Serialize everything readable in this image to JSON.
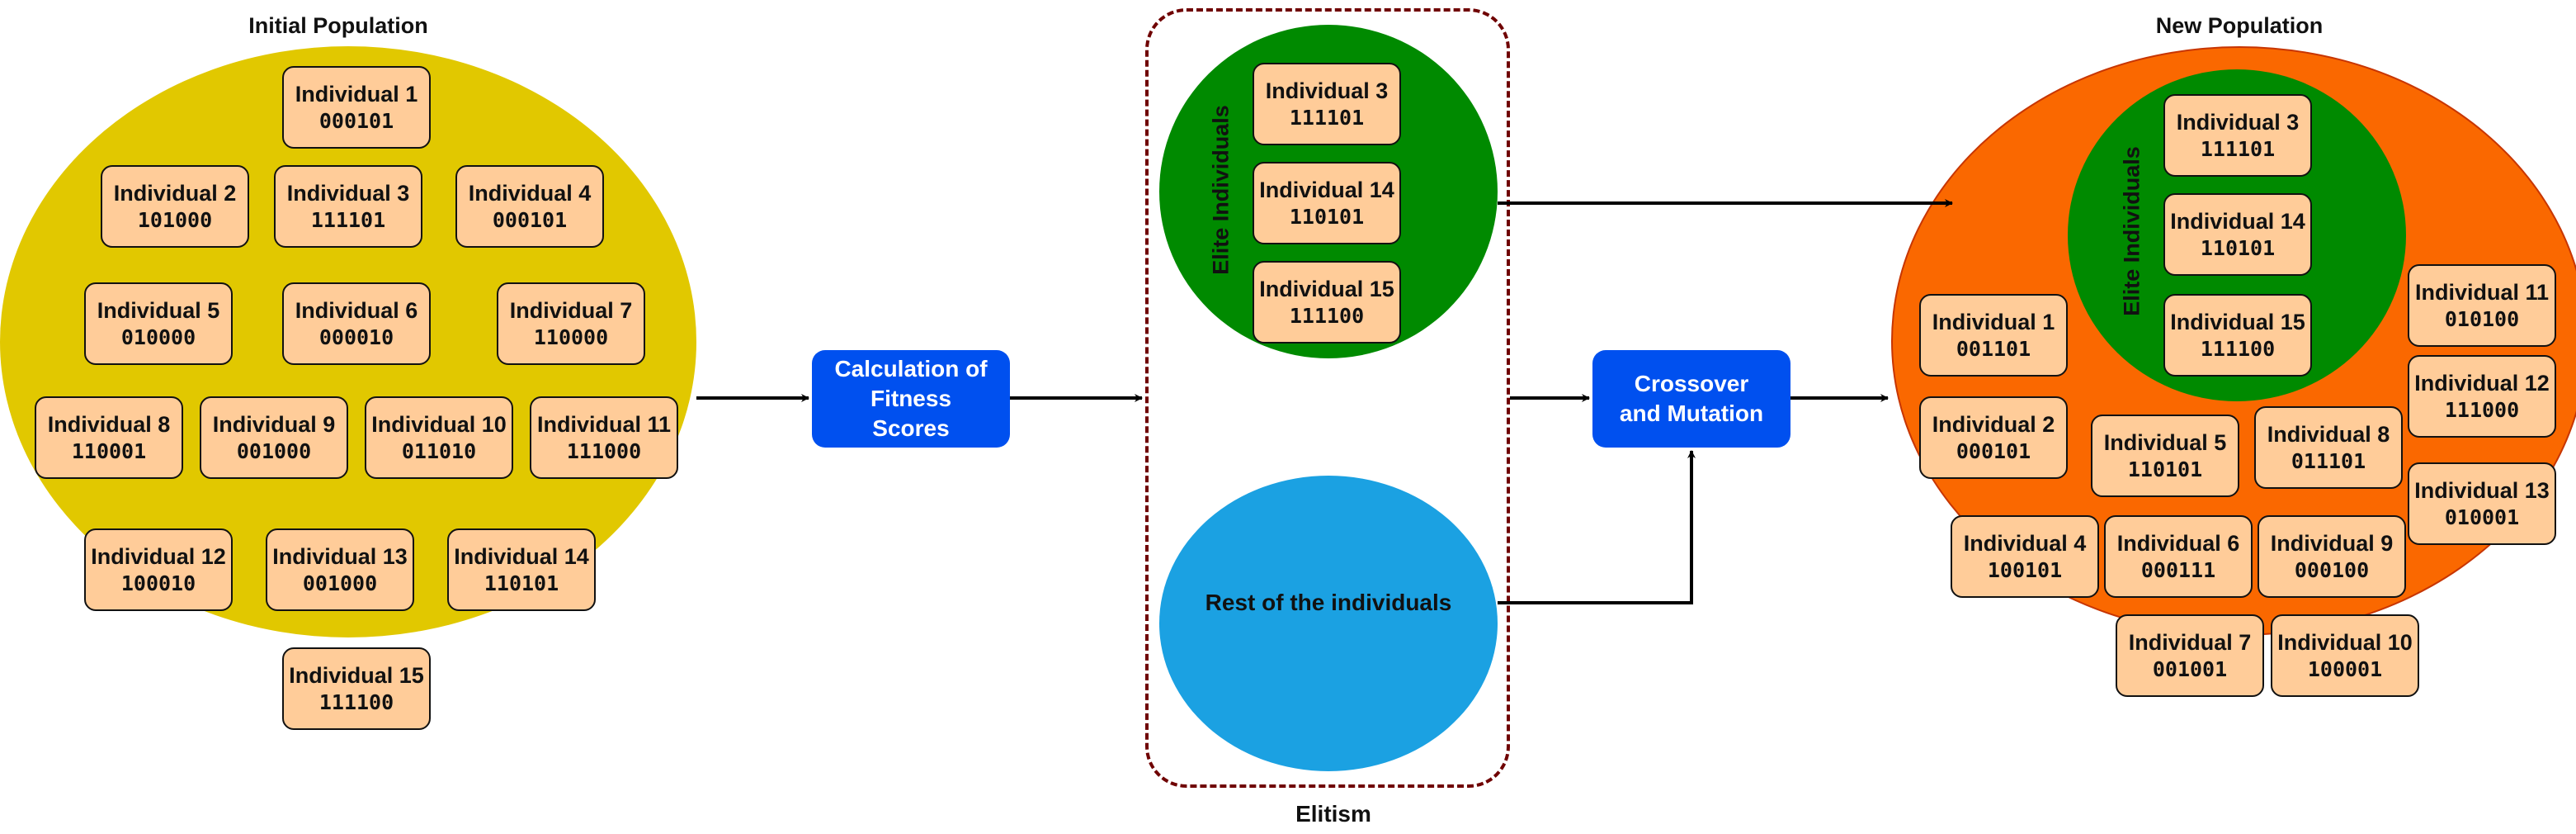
{
  "colors": {
    "initial_population": "#e1c800",
    "new_population": "#fa6800",
    "elite": "#008a00",
    "rest": "#1ba1e2",
    "individual_box": "#ffcc99",
    "process_box": "#0050ef",
    "elitism_border": "#6f0000"
  },
  "initial_population": {
    "title": "Initial Population",
    "individuals": [
      {
        "name": "Individual 1",
        "bits": "000101"
      },
      {
        "name": "Individual 2",
        "bits": "101000"
      },
      {
        "name": "Individual 3",
        "bits": "111101"
      },
      {
        "name": "Individual 4",
        "bits": "000101"
      },
      {
        "name": "Individual 5",
        "bits": "010000"
      },
      {
        "name": "Individual 6",
        "bits": "000010"
      },
      {
        "name": "Individual 7",
        "bits": "110000"
      },
      {
        "name": "Individual 8",
        "bits": "110001"
      },
      {
        "name": "Individual 9",
        "bits": "001000"
      },
      {
        "name": "Individual 10",
        "bits": "011010"
      },
      {
        "name": "Individual 11",
        "bits": "111000"
      },
      {
        "name": "Individual 12",
        "bits": "100010"
      },
      {
        "name": "Individual 13",
        "bits": "001000"
      },
      {
        "name": "Individual 14",
        "bits": "110101"
      },
      {
        "name": "Individual 15",
        "bits": "111100"
      }
    ]
  },
  "fitness": {
    "label": "Calculation of Fitness Scores"
  },
  "elitism": {
    "label": "Elitism",
    "elite_label": "Elite Individuals",
    "elite": [
      {
        "name": "Individual 3",
        "bits": "111101"
      },
      {
        "name": "Individual 14",
        "bits": "110101"
      },
      {
        "name": "Individual 15",
        "bits": "111100"
      }
    ],
    "rest_label": "Rest of the individuals"
  },
  "crossover": {
    "label": "Crossover and Mutation"
  },
  "new_population": {
    "title": "New Population",
    "elite_label": "Elite Individuals",
    "elite": [
      {
        "name": "Individual 3",
        "bits": "111101"
      },
      {
        "name": "Individual 14",
        "bits": "110101"
      },
      {
        "name": "Individual 15",
        "bits": "111100"
      }
    ],
    "individuals": [
      {
        "name": "Individual 1",
        "bits": "001101"
      },
      {
        "name": "Individual 2",
        "bits": "000101"
      },
      {
        "name": "Individual 4",
        "bits": "100101"
      },
      {
        "name": "Individual 5",
        "bits": "110101"
      },
      {
        "name": "Individual 6",
        "bits": "000111"
      },
      {
        "name": "Individual 7",
        "bits": "001001"
      },
      {
        "name": "Individual 8",
        "bits": "011101"
      },
      {
        "name": "Individual 9",
        "bits": "000100"
      },
      {
        "name": "Individual 10",
        "bits": "100001"
      },
      {
        "name": "Individual 11",
        "bits": "010100"
      },
      {
        "name": "Individual 12",
        "bits": "111000"
      },
      {
        "name": "Individual 13",
        "bits": "010001"
      }
    ]
  }
}
